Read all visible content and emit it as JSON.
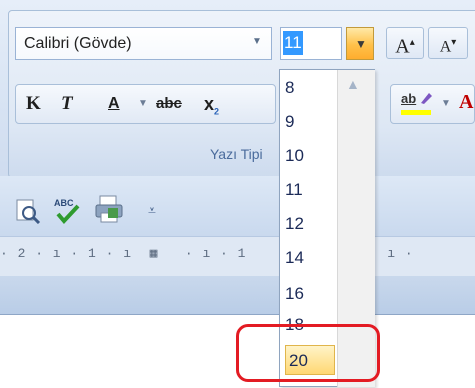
{
  "ribbon": {
    "font_name": "Calibri (Gövde)",
    "font_size": "11",
    "grow_font_label": "A",
    "shrink_font_label": "A",
    "format_buttons": {
      "bold": "K",
      "italic": "T",
      "underline": "A",
      "strikethrough": "abc",
      "subscript": "x",
      "subscript_small": "2"
    },
    "highlight_label": "ab",
    "group_label": "Yazı Tipi"
  },
  "quick_access": {
    "icons": [
      "print-preview-icon",
      "spelling-icon",
      "print-icon",
      "customize-icon"
    ]
  },
  "ruler": {
    "text": "· 2 · ı · 1 · ı  ▦   · ı · 1        ı · 3 · ı ·"
  },
  "font_size_dropdown": {
    "options": [
      "8",
      "9",
      "10",
      "11",
      "12",
      "14",
      "16",
      "18",
      "20"
    ],
    "selected": "20"
  },
  "colors": {
    "annotation_ring": "#e31b23",
    "selection_blue": "#3399ff",
    "hover_orange": "#ffc14a"
  }
}
